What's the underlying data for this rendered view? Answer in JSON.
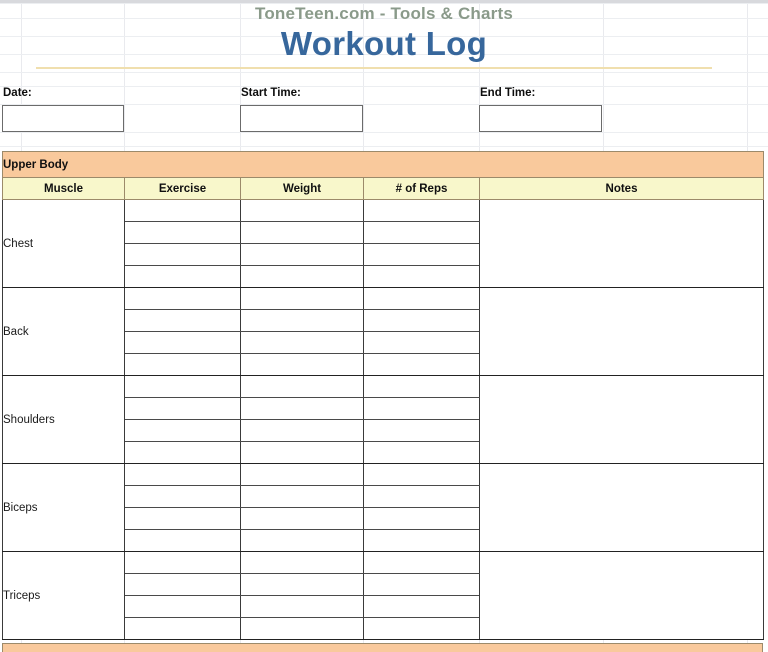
{
  "header": {
    "site_line": "ToneTeen.com - Tools & Charts",
    "title": "Workout Log",
    "site_color": "#8a9a8a",
    "title_color": "#37679c",
    "rule_color": "#f0dfae"
  },
  "meta": {
    "date_label": "Date:",
    "date_value": "",
    "date_placeholder": "",
    "start_time_label": "Start Time:",
    "start_time_value": "",
    "start_time_placeholder": "",
    "end_time_label": "End Time:",
    "end_time_value": "",
    "end_time_placeholder": ""
  },
  "table": {
    "section_title": "Upper Body",
    "section_color": "#f9c99c",
    "header_color": "#f8f7cb",
    "columns": [
      "Muscle",
      "Exercise",
      "Weight",
      "# of Reps",
      "Notes"
    ],
    "rows_per_group": 4,
    "groups": [
      {
        "muscle": "Chest",
        "notes": "",
        "entries": [
          {
            "exercise": "",
            "weight": "",
            "reps": ""
          },
          {
            "exercise": "",
            "weight": "",
            "reps": ""
          },
          {
            "exercise": "",
            "weight": "",
            "reps": ""
          },
          {
            "exercise": "",
            "weight": "",
            "reps": ""
          }
        ]
      },
      {
        "muscle": "Back",
        "notes": "",
        "entries": [
          {
            "exercise": "",
            "weight": "",
            "reps": ""
          },
          {
            "exercise": "",
            "weight": "",
            "reps": ""
          },
          {
            "exercise": "",
            "weight": "",
            "reps": ""
          },
          {
            "exercise": "",
            "weight": "",
            "reps": ""
          }
        ]
      },
      {
        "muscle": "Shoulders",
        "notes": "",
        "entries": [
          {
            "exercise": "",
            "weight": "",
            "reps": ""
          },
          {
            "exercise": "",
            "weight": "",
            "reps": ""
          },
          {
            "exercise": "",
            "weight": "",
            "reps": ""
          },
          {
            "exercise": "",
            "weight": "",
            "reps": ""
          }
        ]
      },
      {
        "muscle": "Biceps",
        "notes": "",
        "entries": [
          {
            "exercise": "",
            "weight": "",
            "reps": ""
          },
          {
            "exercise": "",
            "weight": "",
            "reps": ""
          },
          {
            "exercise": "",
            "weight": "",
            "reps": ""
          },
          {
            "exercise": "",
            "weight": "",
            "reps": ""
          }
        ]
      },
      {
        "muscle": "Triceps",
        "notes": "",
        "entries": [
          {
            "exercise": "",
            "weight": "",
            "reps": ""
          },
          {
            "exercise": "",
            "weight": "",
            "reps": ""
          },
          {
            "exercise": "",
            "weight": "",
            "reps": ""
          },
          {
            "exercise": "",
            "weight": "",
            "reps": ""
          }
        ]
      }
    ]
  }
}
